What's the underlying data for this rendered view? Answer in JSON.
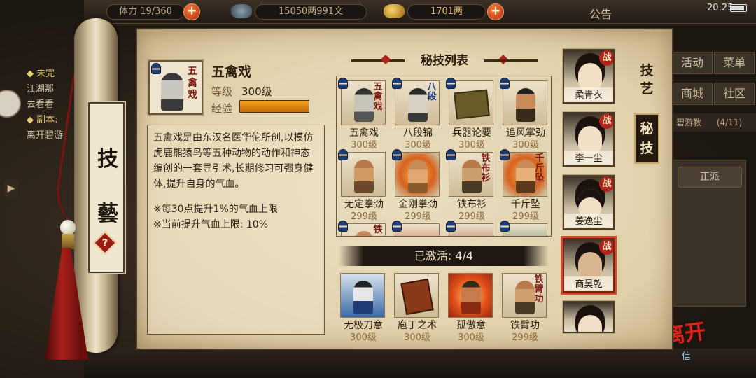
{
  "top_bar": {
    "capacity_label": "体力",
    "capacity_value": "19/360",
    "money": "15050两991文",
    "gold": "1701两",
    "notice_label": "公告",
    "clock": "20:25"
  },
  "left_quests": {
    "line1_head": "◆ 未完",
    "line2": "江湖那",
    "line3": "去看看",
    "line4_head": "◆ 副本:",
    "line5": "离开碧游"
  },
  "right_menu": {
    "activity": "活动",
    "menu": "菜单",
    "shop": "商城",
    "community": "社区",
    "quest_line": "碧游教",
    "quest_progress": "(4/11)",
    "faction_label": "正派"
  },
  "scroll": {
    "title_top": "技",
    "title_bottom": "藝",
    "help": "?"
  },
  "detail": {
    "icon_calligraphy": "五禽戏",
    "name": "五禽戏",
    "level_label": "等级",
    "level_value": "300级",
    "exp_label": "经验",
    "description": "五禽戏是由东汉名医华佗所创,以模仿虎鹿熊猿鸟等五种动物的动作和神态编创的一套导引术,长期修习可强身健体,提升自身的气血。",
    "note1": "※每30点提升1%的气血上限",
    "note2": "※当前提升气血上限: 10%"
  },
  "list": {
    "title": "秘技列表",
    "skills": [
      {
        "name": "五禽戏",
        "level": "300级",
        "calli": "五禽戏"
      },
      {
        "name": "八段锦",
        "level": "300级",
        "calli": "八段"
      },
      {
        "name": "兵器论要",
        "level": "300级",
        "calli": ""
      },
      {
        "name": "追风掌劲",
        "level": "300级",
        "calli": ""
      },
      {
        "name": "无定拳劲",
        "level": "299级",
        "calli": ""
      },
      {
        "name": "金刚拳劲",
        "level": "299级",
        "calli": ""
      },
      {
        "name": "铁布衫",
        "level": "299级",
        "calli": "铁布衫"
      },
      {
        "name": "千斤坠",
        "level": "299级",
        "calli": "千斤坠"
      }
    ],
    "partial_row_calli": [
      "铁",
      "",
      "",
      ""
    ]
  },
  "activated": {
    "label": "已激活: 4/4",
    "skills": [
      {
        "name": "无极刀意",
        "level": "300级"
      },
      {
        "name": "庖丁之术",
        "level": "300级"
      },
      {
        "name": "孤傲意",
        "level": "300级"
      },
      {
        "name": "铁臂功",
        "level": "299级",
        "calli": "铁臂功"
      }
    ]
  },
  "side_tabs": {
    "skill_tab": "技艺",
    "secret_tab": "秘技"
  },
  "characters": [
    {
      "name": "柔青衣",
      "badge": "战"
    },
    {
      "name": "李一尘",
      "badge": "战"
    },
    {
      "name": "姜逸尘",
      "badge": "战"
    },
    {
      "name": "商昊乾",
      "badge": "战"
    },
    {
      "name": "",
      "badge": ""
    }
  ],
  "bottom": {
    "logo_text": "离开",
    "logo_sub": "信"
  },
  "colors": {
    "accent_red": "#b2241a",
    "exp_orange": "#f4a21e",
    "paper": "#e6d6b2"
  }
}
